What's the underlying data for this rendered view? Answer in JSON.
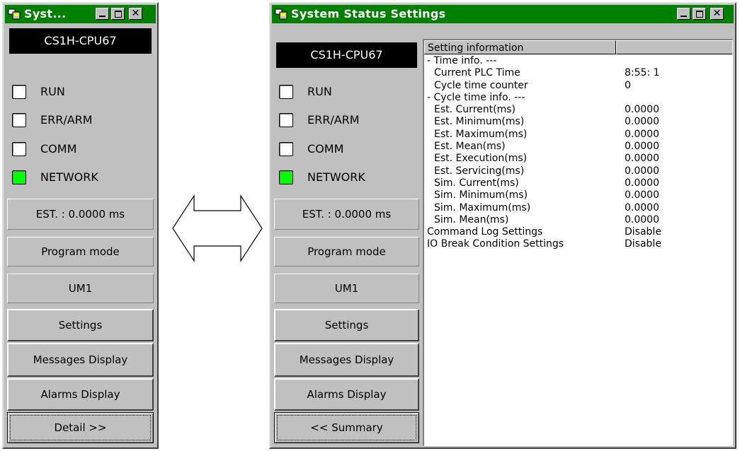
{
  "left_window": {
    "title": "Syst...",
    "cpu": "CS1H-CPU67",
    "leds": [
      {
        "label": "RUN",
        "on": false
      },
      {
        "label": "ERR/ARM",
        "on": false
      },
      {
        "label": "COMM",
        "on": false
      },
      {
        "label": "NETWORK",
        "on": true
      }
    ],
    "est": "EST. : 0.0000 ms",
    "mode": "Program mode",
    "um": "UM1",
    "buttons": {
      "settings": "Settings",
      "messages": "Messages Display",
      "alarms": "Alarms Display",
      "detail": "Detail >>"
    }
  },
  "right_window": {
    "title": "System Status Settings",
    "cpu": "CS1H-CPU67",
    "leds": [
      {
        "label": "RUN",
        "on": false
      },
      {
        "label": "ERR/ARM",
        "on": false
      },
      {
        "label": "COMM",
        "on": false
      },
      {
        "label": "NETWORK",
        "on": true
      }
    ],
    "est": "EST. : 0.0000 ms",
    "mode": "Program mode",
    "um": "UM1",
    "buttons": {
      "settings": "Settings",
      "messages": "Messages Display",
      "alarms": "Alarms Display",
      "summary": "<< Summary"
    },
    "info": {
      "header": "Setting information",
      "header2": "",
      "rows": [
        {
          "k": "- Time info. ---",
          "v": "",
          "ind": false
        },
        {
          "k": "Current PLC Time",
          "v": "8:55: 1",
          "ind": true
        },
        {
          "k": "Cycle time counter",
          "v": "0",
          "ind": true
        },
        {
          "k": "- Cycle time info. ---",
          "v": "",
          "ind": false
        },
        {
          "k": "Est. Current(ms)",
          "v": "0.0000",
          "ind": true
        },
        {
          "k": "Est. Minimum(ms)",
          "v": "0.0000",
          "ind": true
        },
        {
          "k": "Est. Maximum(ms)",
          "v": "0.0000",
          "ind": true
        },
        {
          "k": "Est. Mean(ms)",
          "v": "0.0000",
          "ind": true
        },
        {
          "k": "Est. Execution(ms)",
          "v": "0.0000",
          "ind": true
        },
        {
          "k": "Est. Servicing(ms)",
          "v": "0.0000",
          "ind": true
        },
        {
          "k": "Sim. Current(ms)",
          "v": "0.0000",
          "ind": true
        },
        {
          "k": "Sim. Minimum(ms)",
          "v": "0.0000",
          "ind": true
        },
        {
          "k": "Sim. Maximum(ms)",
          "v": "0.0000",
          "ind": true
        },
        {
          "k": "Sim. Mean(ms)",
          "v": "0.0000",
          "ind": true
        },
        {
          "k": "Command Log Settings",
          "v": "Disable",
          "ind": false
        },
        {
          "k": "IO Break Condition Settings",
          "v": "Disable",
          "ind": false
        }
      ]
    }
  },
  "colors": {
    "titlebar": "#008000",
    "led_on": "#00ff00",
    "face": "#c0c0c0"
  }
}
